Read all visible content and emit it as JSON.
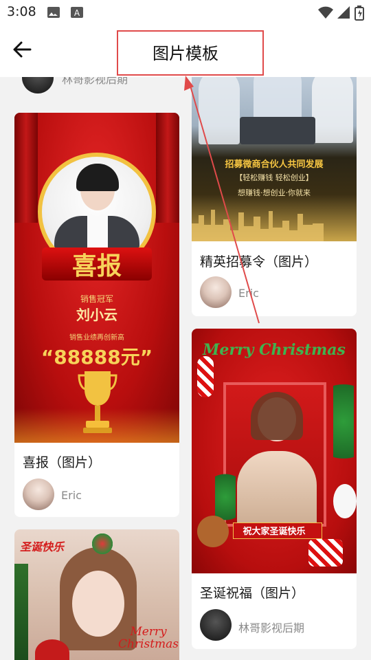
{
  "status_bar": {
    "time": "3:08",
    "icons": [
      "image-icon",
      "font-icon",
      "wifi-icon",
      "signal-icon",
      "battery-icon"
    ]
  },
  "header": {
    "title": "图片模板",
    "back_icon": "arrow-left-icon",
    "highlight_color": "#e04a4a"
  },
  "partial_card": {
    "author": "林哥影视后期"
  },
  "cards": [
    {
      "title": "精英招募令（图片）",
      "author": "Eric",
      "image": {
        "headline": "招募微商合伙人共同发展",
        "sub1": "【轻松赚钱 轻松创业】",
        "sub2": "想赚钱·想创业·你就来"
      }
    },
    {
      "title": "喜报（图片）",
      "author": "Eric",
      "image": {
        "headline": "喜报",
        "award": "销售冠军",
        "name": "刘小云",
        "sub": "销售业绩再创新高",
        "amount": "“88888元”"
      }
    },
    {
      "title": "圣诞祝福（图片）",
      "author": "林哥影视后期",
      "image": {
        "headline": "Merry Christmas",
        "banner": "祝大家圣诞快乐"
      }
    },
    {
      "title": "",
      "author": "",
      "image": {
        "tag": "圣诞快乐",
        "script": "Merry Christmas"
      }
    }
  ],
  "colors": {
    "accent_red": "#d51b1b",
    "gold": "#f5c542",
    "background": "#f2f2f2"
  }
}
